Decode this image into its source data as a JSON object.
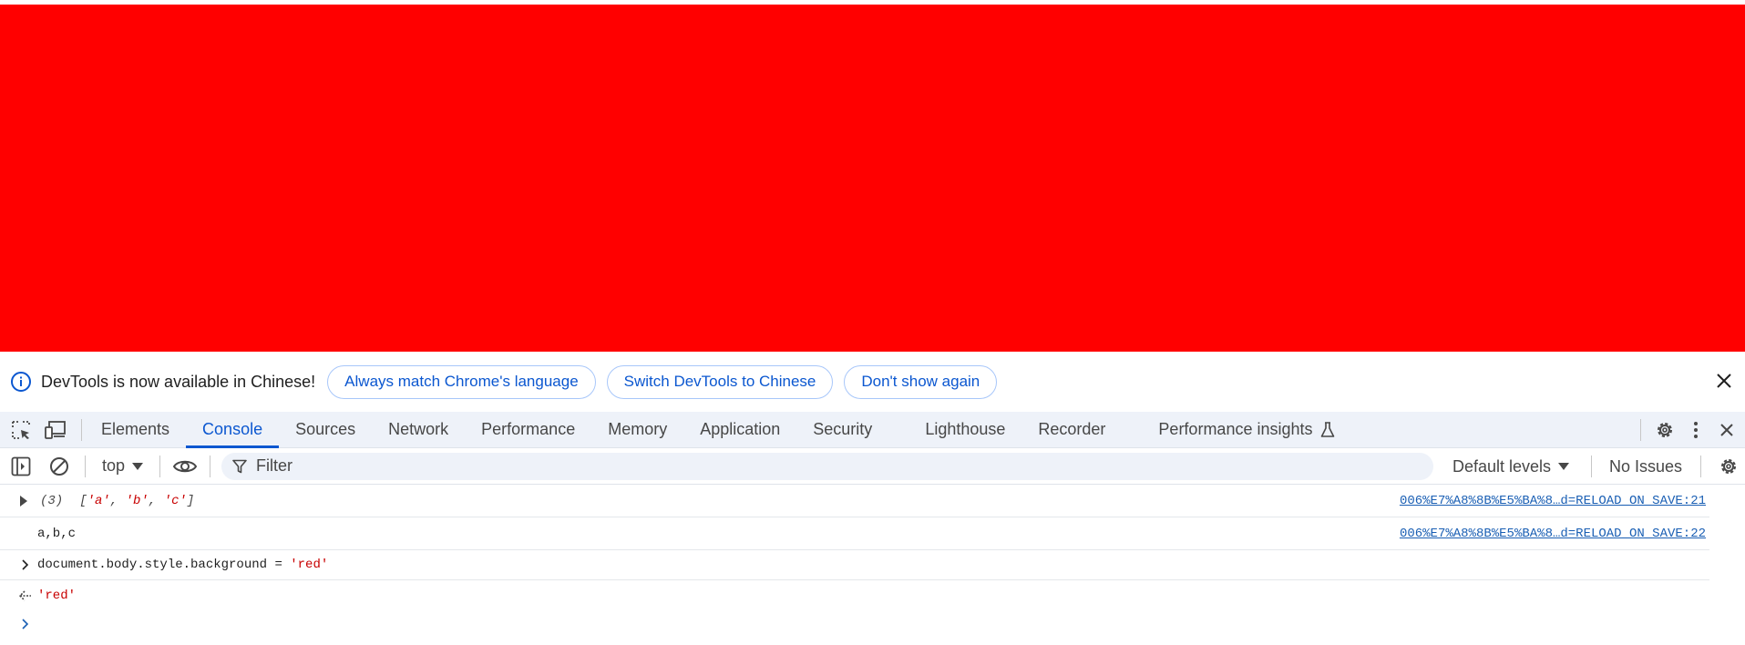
{
  "colors": {
    "page_background": "#ff0000",
    "accent": "#0b57d0",
    "link": "#1a5fb4",
    "string": "#c80000",
    "tabbar_bg": "#eef2f9"
  },
  "infobar": {
    "icon": "info-icon",
    "message": "DevTools is now available in Chinese!",
    "buttons": [
      {
        "label": "Always match Chrome's language"
      },
      {
        "label": "Switch DevTools to Chinese"
      },
      {
        "label": "Don't show again"
      }
    ],
    "close_icon": "close-icon"
  },
  "tabbar": {
    "tabs": [
      {
        "label": "Elements",
        "active": false
      },
      {
        "label": "Console",
        "active": true
      },
      {
        "label": "Sources",
        "active": false
      },
      {
        "label": "Network",
        "active": false
      },
      {
        "label": "Performance",
        "active": false
      },
      {
        "label": "Memory",
        "active": false
      },
      {
        "label": "Application",
        "active": false
      },
      {
        "label": "Security",
        "active": false
      },
      {
        "label": "Lighthouse",
        "active": false
      },
      {
        "label": "Recorder",
        "active": false
      },
      {
        "label": "Performance insights",
        "active": false
      }
    ]
  },
  "console_toolbar": {
    "context": "top",
    "filter_placeholder": "Filter",
    "levels": "Default levels",
    "issues": "No Issues"
  },
  "console": {
    "rows": [
      {
        "kind": "log-array",
        "count": "(3)",
        "items": [
          "'a'",
          "'b'",
          "'c'"
        ],
        "source": "006%E7%A8%8B%E5%BA%8…d=RELOAD_ON_SAVE:21"
      },
      {
        "kind": "log",
        "text": "a,b,c",
        "source": "006%E7%A8%8B%E5%BA%8…d=RELOAD_ON_SAVE:22"
      },
      {
        "kind": "input",
        "code_prefix": "document.body.style.background = ",
        "code_string": "'red'"
      },
      {
        "kind": "result",
        "value": "'red'"
      }
    ]
  }
}
